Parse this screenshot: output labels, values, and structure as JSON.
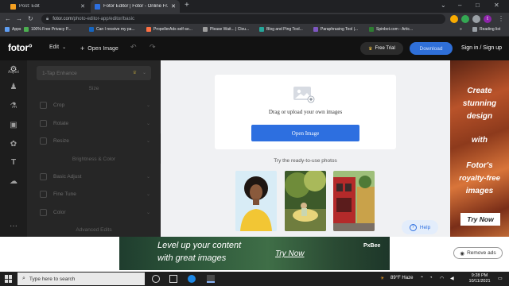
{
  "browser": {
    "tabs": [
      {
        "title": "Post: Edit",
        "favicon_color": "#f4a021"
      },
      {
        "title": "Fotor Editor | Fotor - Online Fr...",
        "favicon_color": "#2d6fe0"
      }
    ],
    "new_tab": "+",
    "window_controls": [
      "⌄",
      "–",
      "□",
      "✕"
    ],
    "url_host": "fotor.com",
    "url_path": "/photo-editor-app/editor/basic",
    "profile_initial": "t",
    "bookmarks": [
      {
        "label": "Apps",
        "color": "#5f9ff5"
      },
      {
        "label": "100% Free Privacy P...",
        "color": "#4caf50"
      },
      {
        "label": "Can I receive my pa...",
        "color": "#1565c0"
      },
      {
        "label": "PropellerAds self-se...",
        "color": "#ff7043"
      },
      {
        "label": "Please Wait... | Clou...",
        "color": "#9e9e9e"
      },
      {
        "label": "Blog and Ping Tool...",
        "color": "#26a69a"
      },
      {
        "label": "Paraphrasing Tool |...",
        "color": "#7e57c2"
      },
      {
        "label": "Spinbot.com - Artic...",
        "color": "#2e7d32"
      }
    ],
    "bookmarks_more": "»",
    "reading_list": "Reading list"
  },
  "fotor": {
    "logo": "fotor°",
    "menu_edit": "Edit",
    "open_image": "Open Image",
    "free_trial": "Free Trial",
    "download": "Download",
    "sign_in": "Sign in / Sign up",
    "rail": [
      {
        "name": "adjust",
        "label": "Adjust",
        "glyph": "⚙"
      },
      {
        "name": "beauty",
        "label": "",
        "glyph": "♟"
      },
      {
        "name": "effects",
        "label": "",
        "glyph": "⚗"
      },
      {
        "name": "frames",
        "label": "",
        "glyph": "▣"
      },
      {
        "name": "stickers",
        "label": "",
        "glyph": "✿"
      },
      {
        "name": "text",
        "label": "",
        "glyph": "T"
      },
      {
        "name": "cloud",
        "label": "",
        "glyph": "☁"
      },
      {
        "name": "more",
        "label": "",
        "glyph": "···"
      }
    ],
    "panel": {
      "preset": "1-Tap Enhance",
      "section_size": "Size",
      "rows_size": [
        "Crop",
        "Rotate",
        "Resize"
      ],
      "section_color": "Brightness & Color",
      "rows_color": [
        "Basic Adjust",
        "Fine Tune",
        "Color"
      ],
      "section_advanced": "Advanced Edits"
    },
    "canvas": {
      "drag_text": "Drag or upload your own images",
      "open_button": "Open Image",
      "try_text": "Try the ready-to-use photos",
      "help": "Help"
    }
  },
  "right_ad": {
    "lines": [
      "Create",
      "stunning",
      "design",
      "with",
      "Fotor's",
      "royalty-free",
      "images"
    ],
    "cta": "Try Now"
  },
  "bottom_ad": {
    "line1": "Level up your content",
    "line2": "with great images",
    "cta": "Try Now",
    "brand": "PxBee",
    "remove": "Remove ads"
  },
  "taskbar": {
    "search_placeholder": "Type here to search",
    "weather": "89°F  Haze",
    "time": "9:28 PM",
    "date": "10/11/2021"
  }
}
